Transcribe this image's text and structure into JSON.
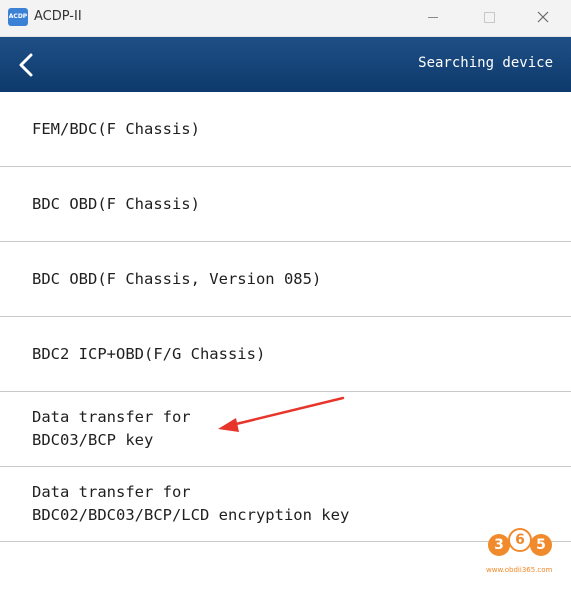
{
  "window": {
    "title": "ACDP-II",
    "app_icon_text": "ACDP",
    "icon": "acdp-app-icon",
    "controls": [
      "minimize-icon",
      "maximize-icon",
      "close-icon"
    ]
  },
  "header": {
    "back_icon": "chevron-left-icon",
    "status": "Searching device",
    "background_color": "#0e3a6c"
  },
  "items": [
    {
      "lines": [
        "FEM/BDC(F Chassis)"
      ]
    },
    {
      "lines": [
        "BDC OBD(F Chassis)"
      ]
    },
    {
      "lines": [
        "BDC OBD(F Chassis, Version 085)"
      ]
    },
    {
      "lines": [
        "BDC2 ICP+OBD(F/G Chassis)"
      ]
    },
    {
      "lines": [
        "Data transfer for",
        "BDC03/BCP key"
      ]
    },
    {
      "lines": [
        "Data transfer for",
        "BDC02/BDC03/BCP/LCD encryption key"
      ]
    }
  ],
  "annotation": {
    "icon": "red-arrow-annotation",
    "color": "#e8352b"
  },
  "watermark": {
    "digits": [
      "3",
      "6",
      "5"
    ],
    "url": "www.obdii365.com",
    "color": "#f08a2c"
  }
}
